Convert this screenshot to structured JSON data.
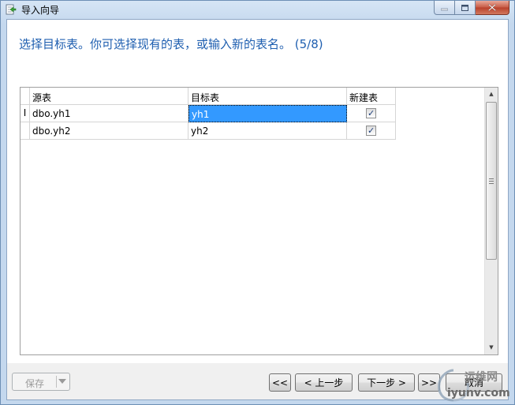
{
  "window": {
    "title": "导入向导"
  },
  "heading": "选择目标表。你可选择现有的表，或输入新的表名。 (5/8)",
  "grid": {
    "columns": [
      "源表",
      "目标表",
      "新建表"
    ],
    "rows": [
      {
        "marker": "I",
        "source": "dbo.yh1",
        "target": "yh1",
        "new_table": true,
        "selected": true
      },
      {
        "marker": "",
        "source": "dbo.yh2",
        "target": "yh2",
        "new_table": true,
        "selected": false
      }
    ]
  },
  "buttons": {
    "save": "保存",
    "first": "<<",
    "prev": "< 上一步",
    "next": "下一步 >",
    "last": ">>",
    "cancel": "取消"
  },
  "watermark": {
    "line1": "运维网",
    "line2": "iyunv.com"
  },
  "colors": {
    "heading": "#1f5fb0",
    "selection": "#3399ff"
  }
}
